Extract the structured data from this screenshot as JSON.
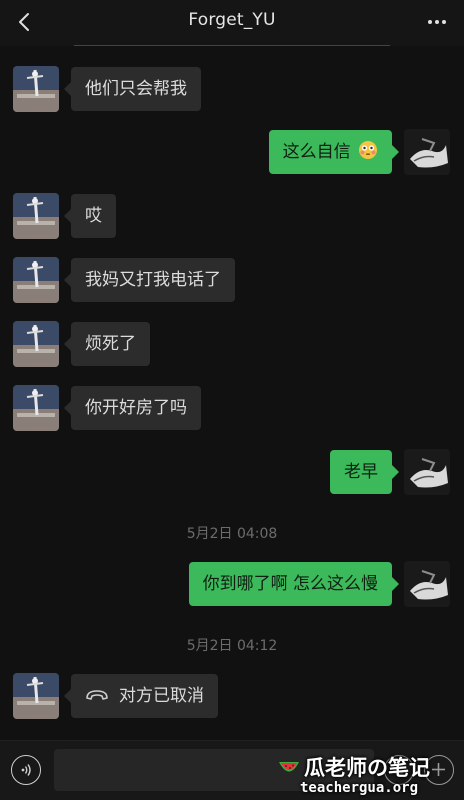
{
  "header": {
    "title": "Forget_YU",
    "back_icon": "chevron-left-icon",
    "more_icon": "more-dots-icon",
    "accent_color": "#1f5a2c"
  },
  "messages": [
    {
      "side": "in",
      "text": "他们只会帮我"
    },
    {
      "side": "out",
      "text": "这么自信",
      "emoji": "flushed-face-emoji"
    },
    {
      "side": "in",
      "text": "哎"
    },
    {
      "side": "in",
      "text": "我妈又打我电话了"
    },
    {
      "side": "in",
      "text": "烦死了"
    },
    {
      "side": "in",
      "text": "你开好房了吗"
    },
    {
      "side": "out",
      "text": "老早"
    },
    {
      "side": "out",
      "text": "你到哪了啊 怎么这么慢"
    },
    {
      "side": "in",
      "text": "对方已取消",
      "icon": "phone-hangup-icon"
    }
  ],
  "timestamps": [
    "5月2日 04:08",
    "5月2日 04:12"
  ],
  "colors": {
    "background": "#111111",
    "incoming_bubble": "#2c2c2c",
    "outgoing_bubble": "#3cb95a",
    "timestamp_text": "#6c6c6c"
  },
  "input_bar": {
    "voice_icon": "voice-icon",
    "placeholder": "",
    "emoji_icon": "emoji-icon",
    "plus_icon": "plus-icon"
  },
  "watermark": {
    "line1": "瓜老师の笔记",
    "line2": "teachergua.org",
    "icon": "watermelon-icon"
  }
}
